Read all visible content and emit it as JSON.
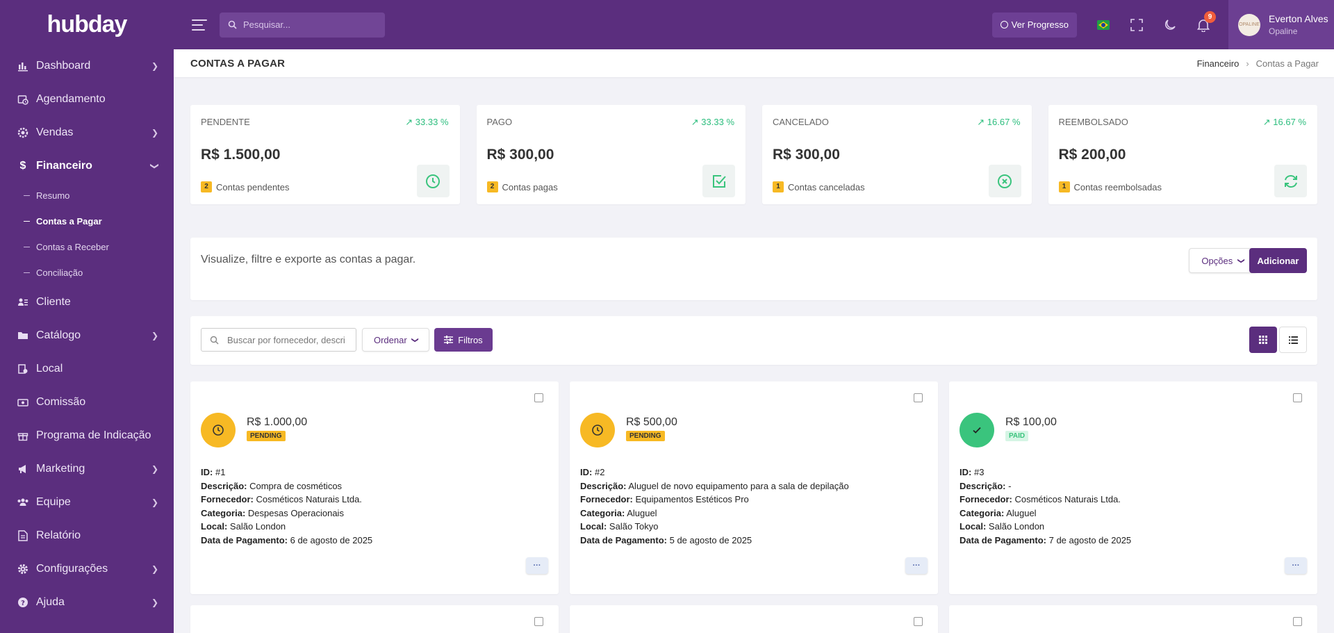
{
  "app": {
    "brand": "hubday"
  },
  "sidebar": {
    "items": [
      {
        "label": "Dashboard",
        "icon": "chart-bar-icon",
        "chevron": true
      },
      {
        "label": "Agendamento",
        "icon": "calendar-clock-icon",
        "chevron": false
      },
      {
        "label": "Vendas",
        "icon": "cog-sale-icon",
        "chevron": true
      },
      {
        "label": "Financeiro",
        "icon": "dollar-icon",
        "chevron": true,
        "expanded": true
      },
      {
        "label": "Cliente",
        "icon": "user-list-icon",
        "chevron": false
      },
      {
        "label": "Catálogo",
        "icon": "folder-icon",
        "chevron": true
      },
      {
        "label": "Local",
        "icon": "location-icon",
        "chevron": false
      },
      {
        "label": "Comissão",
        "icon": "money-icon",
        "chevron": false
      },
      {
        "label": "Programa de Indicação",
        "icon": "gift-icon",
        "chevron": false
      },
      {
        "label": "Marketing",
        "icon": "megaphone-icon",
        "chevron": true
      },
      {
        "label": "Equipe",
        "icon": "users-icon",
        "chevron": true
      },
      {
        "label": "Relatório",
        "icon": "report-icon",
        "chevron": false
      },
      {
        "label": "Configurações",
        "icon": "gear-icon",
        "chevron": true
      },
      {
        "label": "Ajuda",
        "icon": "help-icon",
        "chevron": true
      }
    ],
    "financeiro_sub": [
      {
        "label": "Resumo"
      },
      {
        "label": "Contas a Pagar",
        "active": true
      },
      {
        "label": "Contas a Receber"
      },
      {
        "label": "Conciliação"
      }
    ]
  },
  "topbar": {
    "search_placeholder": "Pesquisar...",
    "progress_label": "Ver Progresso",
    "notifications_count": "9",
    "user_name": "Everton Alves",
    "user_company": "Opaline",
    "avatar_text": "OPALINE"
  },
  "page": {
    "title": "CONTAS A PAGAR",
    "breadcrumb": [
      "Financeiro",
      "Contas a Pagar"
    ]
  },
  "stats": [
    {
      "label": "PENDENTE",
      "pct": "33.33 %",
      "value": "R$ 1.500,00",
      "count": "2",
      "foot": "Contas pendentes",
      "icon": "clock-icon"
    },
    {
      "label": "PAGO",
      "pct": "33.33 %",
      "value": "R$ 300,00",
      "count": "2",
      "foot": "Contas pagas",
      "icon": "check-square-icon"
    },
    {
      "label": "CANCELADO",
      "pct": "16.67 %",
      "value": "R$ 300,00",
      "count": "1",
      "foot": "Contas canceladas",
      "icon": "x-circle-icon"
    },
    {
      "label": "REEMBOLSADO",
      "pct": "16.67 %",
      "value": "R$ 200,00",
      "count": "1",
      "foot": "Contas reembolsadas",
      "icon": "refresh-icon"
    }
  ],
  "info": {
    "description": "Visualize, filtre e exporte as contas a pagar.",
    "options_label": "Opções",
    "add_label": "Adicionar"
  },
  "filters": {
    "search_placeholder": "Buscar por fornecedor, descrição...",
    "sort_label": "Ordenar",
    "filters_label": "Filtros"
  },
  "labels": {
    "id": "ID:",
    "descricao": "Descrição:",
    "fornecedor": "Fornecedor:",
    "categoria": "Categoria:",
    "local": "Local:",
    "data": "Data de Pagamento:",
    "more": "···"
  },
  "accounts": [
    {
      "amount": "R$ 1.000,00",
      "status": "PENDING",
      "status_kind": "pending",
      "id": "#1",
      "descricao": "Compra de cosméticos",
      "fornecedor": "Cosméticos Naturais Ltda.",
      "categoria": "Despesas Operacionais",
      "local": "Salão London",
      "data": "6 de agosto de 2025"
    },
    {
      "amount": "R$ 500,00",
      "status": "PENDING",
      "status_kind": "pending",
      "id": "#2",
      "descricao": "Aluguel de novo equipamento para a sala de depilação",
      "fornecedor": "Equipamentos Estéticos Pro",
      "categoria": "Aluguel",
      "local": "Salão Tokyo",
      "data": "5 de agosto de 2025"
    },
    {
      "amount": "R$ 100,00",
      "status": "PAID",
      "status_kind": "paid",
      "id": "#3",
      "descricao": "-",
      "fornecedor": "Cosméticos Naturais Ltda.",
      "categoria": "Aluguel",
      "local": "Salão London",
      "data": "7 de agosto de 2025"
    }
  ],
  "colors": {
    "primary": "#5b2e7e",
    "pending": "#f7b924",
    "paid": "#3ac47d",
    "positive": "#2dbe7e"
  }
}
